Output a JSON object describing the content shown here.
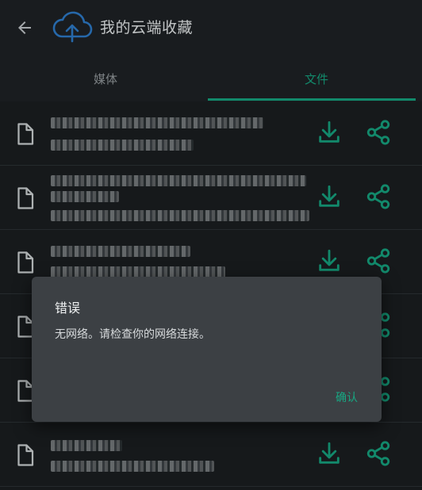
{
  "header": {
    "title": "我的云端收藏",
    "back_icon": "arrow-back-icon",
    "logo_icon": "cloud-upload-icon"
  },
  "tabs": [
    {
      "label": "媒体"
    },
    {
      "label": "文件"
    }
  ],
  "selected_tab": "文件",
  "colors": {
    "accent": "#17a883",
    "background": "#1b1f22",
    "dialog": "#3c4044",
    "icon_blue": "#2f7fd0"
  },
  "files": [
    {
      "icon": "file-icon",
      "actions": [
        "download-icon",
        "share-icon"
      ]
    },
    {
      "icon": "file-icon",
      "actions": [
        "download-icon",
        "share-icon"
      ]
    },
    {
      "icon": "file-icon",
      "actions": [
        "download-icon",
        "share-icon"
      ]
    },
    {
      "icon": "file-icon",
      "actions": [
        "download-icon",
        "share-icon"
      ]
    },
    {
      "icon": "file-icon",
      "actions": [
        "download-icon",
        "share-icon"
      ]
    },
    {
      "icon": "file-icon",
      "actions": [
        "download-icon",
        "share-icon"
      ]
    }
  ],
  "dialog": {
    "title": "错误",
    "message": "无网络。请检查你的网络连接。",
    "confirm_label": "确认"
  }
}
